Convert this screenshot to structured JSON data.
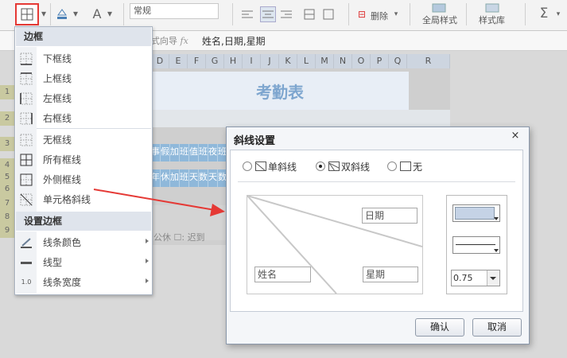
{
  "toolbar": {
    "format_value": "常规",
    "delete_label": "删除",
    "global_style_label": "全局样式",
    "style_lib_label": "样式库",
    "sum_icon": "Σ"
  },
  "formula_bar": {
    "label_wizard": "式向导",
    "fx": "fx",
    "value": "姓名,日期,星期"
  },
  "sheet": {
    "columns": [
      "D",
      "E",
      "F",
      "G",
      "H",
      "I",
      "J",
      "K",
      "L",
      "M",
      "N",
      "O",
      "P",
      "Q",
      "R"
    ],
    "title": "考勤表",
    "row1_cells": [
      "事",
      "假",
      "加",
      "班",
      "值",
      "班",
      "夜",
      "班"
    ],
    "row2_cells": [
      "年",
      "休",
      "加",
      "班",
      "天",
      "数",
      "天",
      "数"
    ],
    "row_nums": [
      "1",
      "2",
      "3",
      "4",
      "5",
      "6",
      "7",
      "8",
      "9"
    ],
    "footer_text": "公休",
    "footer_text2": "迟到"
  },
  "border_menu": {
    "section1_title": "边框",
    "items": [
      {
        "label": "下框线",
        "icon": "border-bottom-icon"
      },
      {
        "label": "上框线",
        "icon": "border-top-icon"
      },
      {
        "label": "左框线",
        "icon": "border-left-icon"
      },
      {
        "label": "右框线",
        "icon": "border-right-icon"
      },
      {
        "label": "无框线",
        "icon": "border-none-icon"
      },
      {
        "label": "所有框线",
        "icon": "border-all-icon"
      },
      {
        "label": "外侧框线",
        "icon": "border-outside-icon"
      },
      {
        "label": "单元格斜线",
        "icon": "cell-diagonal-icon"
      }
    ],
    "section2_title": "设置边框",
    "settings": [
      {
        "label": "线条颜色",
        "icon": "line-color-icon"
      },
      {
        "label": "线型",
        "icon": "line-style-icon"
      },
      {
        "label": "线条宽度",
        "icon": "line-width-icon",
        "icon_text": "1.0"
      }
    ]
  },
  "dialog": {
    "title": "斜线设置",
    "close": "×",
    "options": [
      {
        "label": "单斜线",
        "selected": false
      },
      {
        "label": "双斜线",
        "selected": true
      },
      {
        "label": "无",
        "selected": false
      }
    ],
    "field_date": "日期",
    "field_name": "姓名",
    "field_week": "星期",
    "line_width": "0.75",
    "ok": "确认",
    "cancel": "取消"
  },
  "colors": {
    "highlight": "#e53935",
    "header_blue": "#8fb8da",
    "title_blue": "#7ea6cf"
  }
}
